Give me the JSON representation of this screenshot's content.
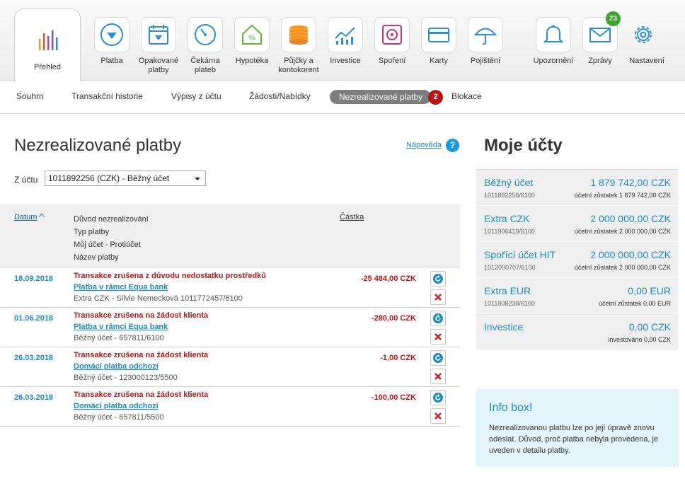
{
  "topnav": {
    "items": [
      {
        "label": "Přehled",
        "icon": "chart-bars-icon"
      },
      {
        "label": "Platba",
        "icon": "arrow-down-circle-icon"
      },
      {
        "label": "Opakované platby",
        "icon": "calendar-download-icon"
      },
      {
        "label": "Čekárna plateb",
        "icon": "gauge-icon"
      },
      {
        "label": "Hypotéka",
        "icon": "house-percent-icon"
      },
      {
        "label": "Půjčky a kontokorent",
        "icon": "coin-stack-icon"
      },
      {
        "label": "Investice",
        "icon": "line-chart-icon"
      },
      {
        "label": "Spoření",
        "icon": "safe-icon"
      },
      {
        "label": "Karty",
        "icon": "credit-card-icon"
      },
      {
        "label": "Pojištění",
        "icon": "umbrella-icon"
      },
      {
        "label": "Upozornění",
        "icon": "bell-icon"
      },
      {
        "label": "Zprávy",
        "icon": "envelope-icon",
        "badge": "23"
      },
      {
        "label": "Nastavení",
        "icon": "gear-icon"
      }
    ]
  },
  "subnav": {
    "tabs": [
      "Souhrn",
      "Transakční historie",
      "Výpisy z účtu",
      "Žádosti/Nabídky",
      "Nezrealizované platby",
      "Blokace"
    ],
    "active_badge": "2"
  },
  "main": {
    "title": "Nezrealizované platby",
    "help_label": "Nápověda",
    "help_icon_text": "?",
    "account_label": "Z účtu",
    "account_selected": "1011892256 (CZK) - Běžný účet"
  },
  "table": {
    "header": {
      "date": "Datum",
      "reason_lines": [
        "Důvod nezrealizování",
        "Typ platby",
        "Můj účet - Protiúčet",
        "Název platby"
      ],
      "amount": "Částka"
    },
    "rows": [
      {
        "date": "18.09.2018",
        "reason": "Transakce zrušena z důvodu nedostatku prostředků",
        "type": "Platba v rámci Equa bank",
        "accounts": "Extra CZK - Silvie Nemecková 1011772457/6100",
        "amount": "-25 484,00 CZK"
      },
      {
        "date": "01.06.2018",
        "reason": "Transakce zrušena na žádost klienta",
        "type": "Platba v rámci Equa bank",
        "accounts": "Běžný účet - 657811/6100",
        "amount": "-280,00 CZK"
      },
      {
        "date": "26.03.2018",
        "reason": "Transakce zrušena na žádost klienta",
        "type": "Domácí platba odchozí",
        "accounts": "Běžný účet - 123000123/5500",
        "amount": "-1,00 CZK"
      },
      {
        "date": "26.03.2018",
        "reason": "Transakce zrušena na žádost klienta",
        "type": "Domácí platba odchozí",
        "accounts": "Běžný účet - 657811/5500",
        "amount": "-100,00 CZK"
      }
    ]
  },
  "sidebar": {
    "title": "Moje účty",
    "accounts": [
      {
        "name": "Běžný účet",
        "number": "1011892256/6100",
        "balance": "1 879 742,00 CZK",
        "sub": "účetní zůstatek 1 879 742,00 CZK"
      },
      {
        "name": "Extra CZK",
        "number": "1011906419/6100",
        "balance": "2 000 000,00 CZK",
        "sub": "účetní zůstatek 2 000 000,00 CZK"
      },
      {
        "name": "Spořící účet HIT",
        "number": "1012000707/6100",
        "balance": "2 000 000,00 CZK",
        "sub": "účetní zůstatek 2 000 000,00 CZK"
      },
      {
        "name": "Extra EUR",
        "number": "1011908238/6100",
        "balance": "0,00 EUR",
        "sub": "účetní zůstatek 0,00 EUR"
      },
      {
        "name": "Investice",
        "number": "",
        "balance": "0,00 CZK",
        "sub": "investováno 0,00 CZK"
      }
    ],
    "infobox": {
      "title": "Info box!",
      "text": "Nezrealizovanou platbu lze po její úpravě znovu odeslat. Důvod, proč platba nebyla provedena, je uveden v detailu platby."
    }
  },
  "colors": {
    "accent_blue": "#1c8bc6",
    "error_red": "#b51616",
    "badge_green": "#3aa52c"
  }
}
